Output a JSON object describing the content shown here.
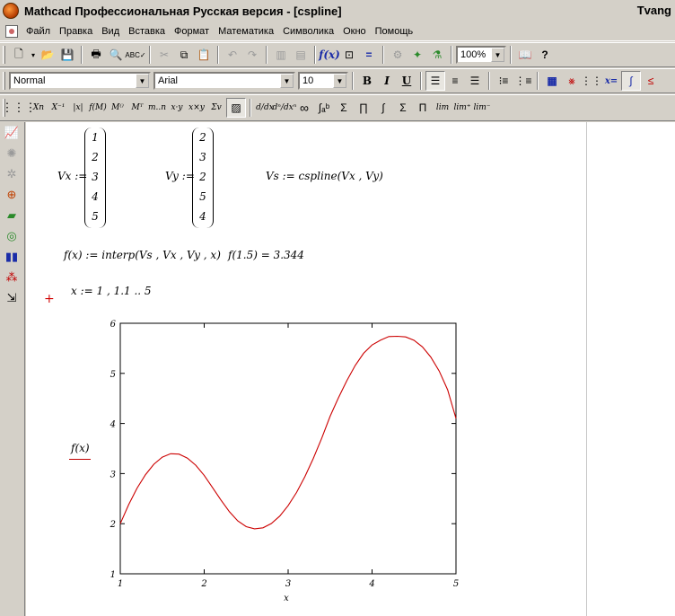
{
  "window": {
    "title": "Mathcad Профессиональная Русская версия - [cspline]",
    "right_text": "Tvang"
  },
  "menu": [
    "Файл",
    "Правка",
    "Вид",
    "Вставка",
    "Формат",
    "Математика",
    "Символика",
    "Окно",
    "Помощь"
  ],
  "toolbar": {
    "zoom": "100%",
    "style": "Normal",
    "font": "Arial",
    "size": "10",
    "bold": "B",
    "italic": "I",
    "underline": "U"
  },
  "worksheet": {
    "vx_label": "Vx :=",
    "vx_values": [
      "1",
      "2",
      "3",
      "4",
      "5"
    ],
    "vy_label": "Vy :=",
    "vy_values": [
      "2",
      "3",
      "2",
      "5",
      "4"
    ],
    "vs_def": "Vs := cspline(Vx , Vy)",
    "f_def": "f(x) := interp(Vs , Vx , Vy , x)",
    "f_eval": "f(1.5) = 3.344",
    "x_range": "x := 1 , 1.1 .. 5",
    "cursor": "+"
  },
  "chart_data": {
    "type": "line",
    "xlabel": "x",
    "ylabel": "f(x)",
    "xlim": [
      1,
      5
    ],
    "ylim": [
      1,
      6
    ],
    "xticks": [
      "1",
      "2",
      "3",
      "4",
      "5"
    ],
    "yticks": [
      "1",
      "2",
      "3",
      "4",
      "5",
      "6"
    ],
    "grid": false,
    "line_color": "#cc0000",
    "series": [
      {
        "x": [
          1.0,
          1.1,
          1.2,
          1.3,
          1.4,
          1.5,
          1.6,
          1.7,
          1.8,
          1.9,
          2.0,
          2.1,
          2.2,
          2.3,
          2.4,
          2.5,
          2.6,
          2.7,
          2.8,
          2.9,
          3.0,
          3.1,
          3.2,
          3.3,
          3.4,
          3.5,
          3.6,
          3.7,
          3.8,
          3.9,
          4.0,
          4.1,
          4.2,
          4.3,
          4.4,
          4.5,
          4.6,
          4.7,
          4.8,
          4.9,
          5.0
        ],
        "values": [
          2.0,
          2.381,
          2.709,
          2.979,
          3.187,
          3.328,
          3.396,
          3.389,
          3.309,
          3.166,
          2.964,
          2.717,
          2.471,
          2.241,
          2.056,
          1.941,
          1.897,
          1.918,
          2.004,
          2.152,
          2.36,
          2.624,
          2.94,
          3.301,
          3.705,
          4.145,
          4.514,
          4.859,
          5.16,
          5.401,
          5.567,
          5.662,
          5.734,
          5.74,
          5.727,
          5.659,
          5.529,
          5.327,
          5.046,
          4.672,
          4.1
        ]
      }
    ]
  }
}
